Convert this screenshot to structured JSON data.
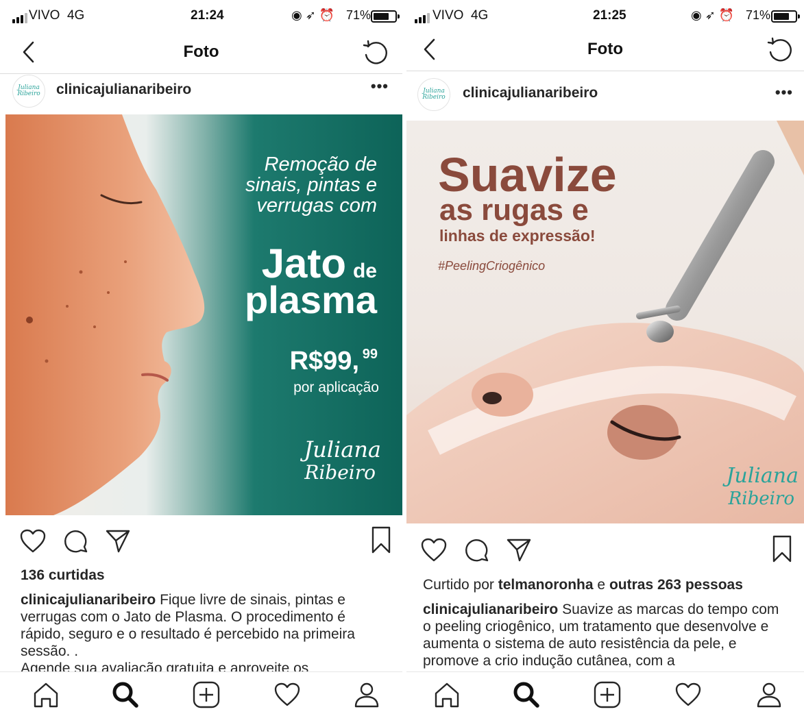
{
  "left": {
    "status": {
      "carrier": "VIVO",
      "network": "4G",
      "time": "21:24",
      "battery": "71%"
    },
    "nav_title": "Foto",
    "post": {
      "username": "clinicajulianaribeiro",
      "more": "•••",
      "avatar_text": "Juliana Ribeiro",
      "image": {
        "headline": [
          "Remoção de",
          "sinais, pintas e",
          "verrugas com"
        ],
        "product_main": "Jato",
        "product_de": "de",
        "product_second": "plasma",
        "price_main": "R$99,",
        "price_cents": "99",
        "price_unit": "por aplicação",
        "logo_line1": "Juliana",
        "logo_line2": "Ribeiro"
      },
      "likes": "136 curtidas",
      "caption_user": "clinicajulianaribeiro",
      "caption_text": " Fique livre de sinais, pintas e verrugas com o Jato de Plasma. O procedimento é rápido, seguro e o resultado é percebido na primeira sessão. .",
      "caption_more": "Agende sua avaliação gratuita e aproveite os"
    }
  },
  "right": {
    "status": {
      "carrier": "VIVO",
      "network": "4G",
      "time": "21:25",
      "battery": "71%"
    },
    "nav_title": "Foto",
    "post": {
      "username": "clinicajulianaribeiro",
      "more": "•••",
      "avatar_text": "Juliana Ribeiro",
      "image": {
        "line1": "Suavize",
        "line2": "as rugas e",
        "line3": "linhas de expressão!",
        "hashtag": "#PeelingCriogênico",
        "logo_line1": "Juliana",
        "logo_line2": "Ribeiro"
      },
      "likes_prefix": "Curtido por ",
      "likes_user": "telmanoronha",
      "likes_mid": " e ",
      "likes_others": "outras 263 pessoas",
      "caption_user": "clinicajulianaribeiro",
      "caption_text": " Suavize as marcas do tempo com o peeling criogênico, um tratamento que desenvolve e aumenta o sistema de auto resistência da pele, e promove a crio indução cutânea, com a"
    }
  },
  "colors": {
    "teal": "#0f6d62",
    "brown": "#8a4a3c",
    "logo_teal": "#2aa39a"
  }
}
